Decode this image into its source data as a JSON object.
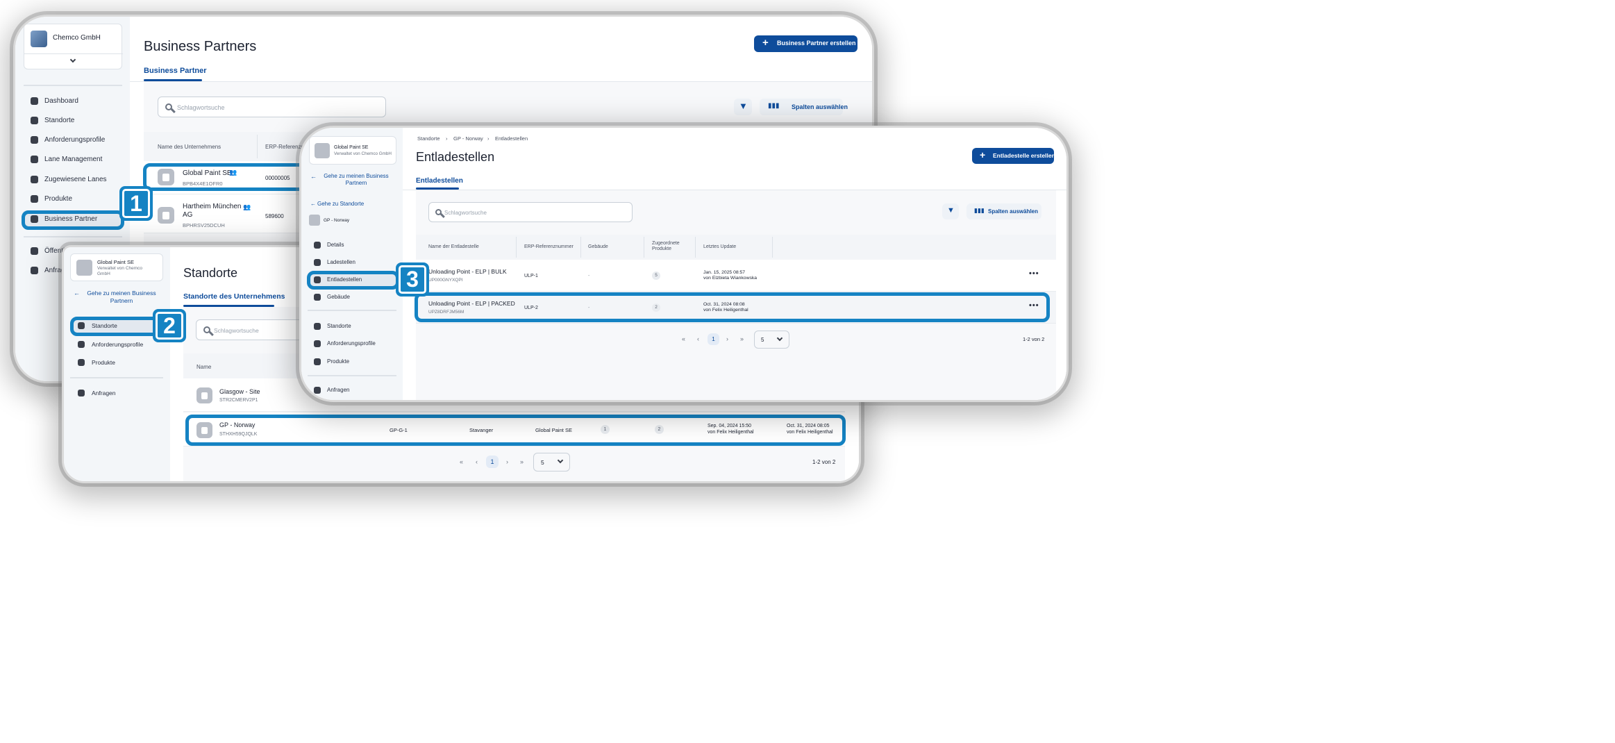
{
  "shot1": {
    "org_name": "Chemco GmbH",
    "nav": [
      "Dashboard",
      "Standorte",
      "Anforderungsprofile",
      "Lane Management",
      "Zugewiesene Lanes",
      "Produkte",
      "Business Partner"
    ],
    "nav_lower": [
      "Öffentli",
      "Anfrag"
    ],
    "title": "Business Partners",
    "create_button": "Business Partner erstellen",
    "tab": "Business Partner",
    "search_placeholder": "Schlagwortsuche",
    "columns_button": "Spalten auswählen",
    "headers": [
      "Name des Unternehmens",
      "ERP-Referenzn"
    ],
    "rows": [
      {
        "name": "Global Paint SE",
        "id": "BPB4X4E1OFR0",
        "erp": "00000005"
      },
      {
        "name": "Hartheim München AG",
        "id": "BPHRSV25DCUH",
        "erp": "589600"
      }
    ]
  },
  "shot2": {
    "org_name": "Global Paint SE",
    "org_sub": "Verwaltet von Chemco GmbH",
    "back_link": "Gehe zu meinen Business Partnern",
    "nav": [
      "Standorte",
      "Anforderungsprofile",
      "Produkte",
      "Anfragen"
    ],
    "title": "Standorte",
    "tab": "Standorte des Unternehmens",
    "search_placeholder": "Schlagwortsuche",
    "header_name": "Name",
    "rows": [
      {
        "name": "Glasgow - Site",
        "id": "STR2CMERV2P1"
      },
      {
        "name": "GP - Norway",
        "id": "STHXH59QJQLK",
        "ref": "GP-G-1",
        "city": "Stavanger",
        "partner": "Global Paint SE",
        "count1": "1",
        "count2": "2",
        "date1": "Sep. 04, 2024 15:50",
        "by1": "von Felix Heiligenthal",
        "date2": "Oct. 31, 2024 08:05",
        "by2": "von Felix Heiligenthal"
      }
    ],
    "pager": {
      "page": "1",
      "size": "5",
      "summary": "1-2 von 2"
    }
  },
  "shot3": {
    "org_name": "Global Paint SE",
    "org_sub": "Verwaltet von Chemco GmbH",
    "back_link": "Gehe zu meinen Business Partnern",
    "back_link2": "Gehe zu Standorte",
    "site_name": "GP - Norway",
    "nav": [
      "Details",
      "Ladestellen",
      "Entladestellen",
      "Gebäude"
    ],
    "nav2": [
      "Standorte",
      "Anforderungsprofile",
      "Produkte"
    ],
    "nav3": [
      "Anfragen"
    ],
    "breadcrumb": [
      "Standorte",
      "GP - Norway",
      "Entladestellen"
    ],
    "title": "Entladestellen",
    "create_button": "Entladestelle erstellen",
    "tab": "Entladestellen",
    "search_placeholder": "Schlagwortsuche",
    "columns_button": "Spalten auswählen",
    "headers": [
      "Name der Entladestelle",
      "ERP-Referenznummer",
      "Gebäude",
      "Zugeordnete Produkte",
      "Letztes Update"
    ],
    "rows": [
      {
        "name": "Unloading Point - ELP | BULK",
        "id": "UP000GNYXQPI",
        "erp": "ULP-1",
        "building": "-",
        "count": "5",
        "date": "Jan. 15, 2025 08:57",
        "by": "von Elzbieta Wiankowska"
      },
      {
        "name": "Unloading Point - ELP | PACKED",
        "id": "UPZ8DRFJM56M",
        "erp": "ULP-2",
        "building": "-",
        "count": "2",
        "date": "Oct. 31, 2024 08:08",
        "by": "von Felix Heiligenthal"
      }
    ],
    "pager": {
      "page": "1",
      "size": "5",
      "summary": "1-2 von 2"
    }
  },
  "steps": [
    "1",
    "2",
    "3"
  ],
  "accent_color": "#1583c3",
  "primary_color": "#0e4c9b"
}
